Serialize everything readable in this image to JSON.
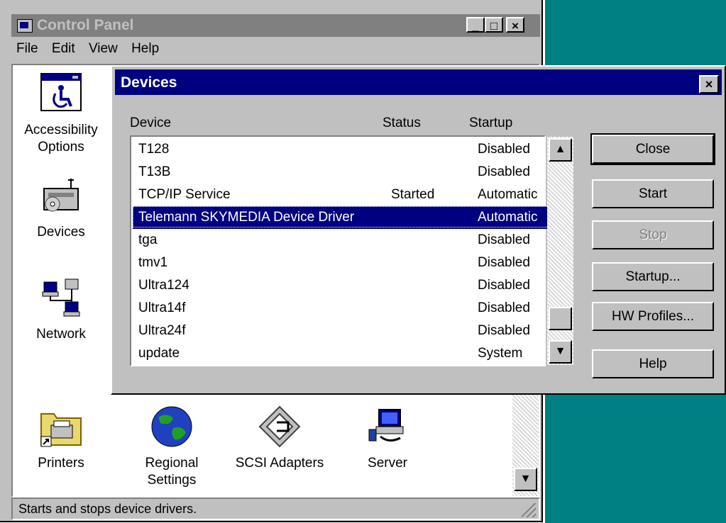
{
  "control_panel": {
    "title": "Control Panel",
    "window_buttons": {
      "minimize": "_",
      "maximize": "□",
      "close": "×"
    },
    "menu": [
      "File",
      "Edit",
      "View",
      "Help"
    ],
    "icons": [
      {
        "label_1": "Accessibility",
        "label_2": "Options",
        "icon": "accessibility-icon"
      },
      {
        "label_1": "Devices",
        "icon": "devices-icon"
      },
      {
        "label_1": "Network",
        "icon": "network-icon"
      },
      {
        "label_1": "Printers",
        "icon": "printers-icon"
      },
      {
        "label_1": "Regional",
        "label_2": "Settings",
        "icon": "regional-settings-icon"
      },
      {
        "label_1": "SCSI Adapters",
        "icon": "scsi-adapters-icon"
      },
      {
        "label_1": "Server",
        "icon": "server-icon"
      }
    ],
    "status_text": "Starts and stops device drivers."
  },
  "devices_dialog": {
    "title": "Devices",
    "close_glyph": "×",
    "columns": {
      "device": "Device",
      "status": "Status",
      "startup": "Startup"
    },
    "rows": [
      {
        "device": "T128",
        "status": "",
        "startup": "Disabled"
      },
      {
        "device": "T13B",
        "status": "",
        "startup": "Disabled"
      },
      {
        "device": "TCP/IP Service",
        "status": "Started",
        "startup": "Automatic"
      },
      {
        "device": "Telemann SKYMEDIA Device Driver",
        "status": "",
        "startup": "Automatic"
      },
      {
        "device": "tga",
        "status": "",
        "startup": "Disabled"
      },
      {
        "device": "tmv1",
        "status": "",
        "startup": "Disabled"
      },
      {
        "device": "Ultra124",
        "status": "",
        "startup": "Disabled"
      },
      {
        "device": "Ultra14f",
        "status": "",
        "startup": "Disabled"
      },
      {
        "device": "Ultra24f",
        "status": "",
        "startup": "Disabled"
      },
      {
        "device": "update",
        "status": "",
        "startup": "System"
      }
    ],
    "selected_row": "Telemann SKYMEDIA Device Driver",
    "buttons": {
      "close": "Close",
      "start": "Start",
      "stop": "Stop",
      "startup": "Startup...",
      "hw_profiles": "HW Profiles...",
      "help": "Help"
    }
  },
  "colors": {
    "desktop": "#008080",
    "active_title": "#000080",
    "inactive_title": "#808080",
    "face": "#c0c0c0"
  }
}
